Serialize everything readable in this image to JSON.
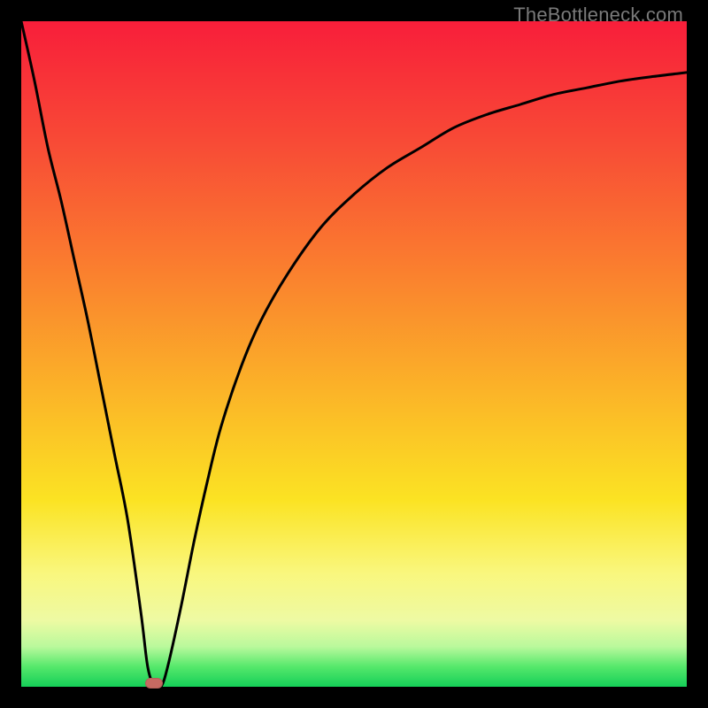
{
  "watermark": "TheBottleneck.com",
  "chart_data": {
    "type": "line",
    "title": "",
    "xlabel": "",
    "ylabel": "",
    "xlim": [
      0,
      100
    ],
    "ylim": [
      0,
      100
    ],
    "grid": false,
    "legend": false,
    "marker": {
      "x": 20,
      "y": 0,
      "color": "#c76a62"
    },
    "gradient_colors": {
      "top": "#f81e3a",
      "mid_upper": "#fa7b2f",
      "mid": "#fbe323",
      "mid_lower": "#eefaa3",
      "bottom": "#15cf58"
    },
    "series": [
      {
        "name": "bottleneck-curve",
        "color": "#000000",
        "x": [
          0,
          2,
          4,
          6,
          8,
          10,
          12,
          14,
          16,
          18,
          19,
          20,
          21,
          22,
          24,
          26,
          28,
          30,
          33,
          36,
          40,
          45,
          50,
          55,
          60,
          65,
          70,
          75,
          80,
          85,
          90,
          95,
          100
        ],
        "y": [
          100,
          91,
          81,
          73,
          64,
          55,
          45,
          35,
          25,
          11,
          3,
          0,
          0,
          3,
          12,
          22,
          31,
          39,
          48,
          55,
          62,
          69,
          74,
          78,
          81,
          84,
          86,
          87.5,
          89,
          90,
          91,
          91.7,
          92.3
        ]
      }
    ]
  }
}
